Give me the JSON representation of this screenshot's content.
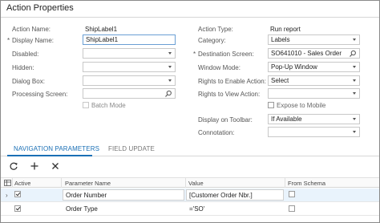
{
  "window": {
    "title": "Action Properties"
  },
  "form": {
    "action_name_label": "Action Name:",
    "action_name_value": "ShipLabel1",
    "display_name_label": "Display Name:",
    "display_name_value": "ShipLabel1",
    "disabled_label": "Disabled:",
    "hidden_label": "Hidden:",
    "dialog_box_label": "Dialog Box:",
    "processing_screen_label": "Processing Screen:",
    "batch_mode_label": "Batch Mode",
    "batch_mode_checked": false,
    "action_type_label": "Action Type:",
    "action_type_value": "Run report",
    "category_label": "Category:",
    "category_value": "Labels",
    "destination_screen_label": "Destination Screen:",
    "destination_screen_value": "SO641010 - Sales Order",
    "window_mode_label": "Window Mode:",
    "window_mode_value": "Pop-Up Window",
    "rights_enable_label": "Rights to Enable Action:",
    "rights_enable_value": "Select",
    "rights_view_label": "Rights to View Action:",
    "expose_mobile_label": "Expose to Mobile",
    "expose_mobile_checked": false,
    "display_toolbar_label": "Display on Toolbar:",
    "display_toolbar_value": "If Available",
    "connotation_label": "Connotation:",
    "required_marker": "*"
  },
  "tabs": [
    {
      "label": "NAVIGATION PARAMETERS",
      "active": true
    },
    {
      "label": "FIELD UPDATE",
      "active": false
    }
  ],
  "toolbar": {
    "refresh_icon": "refresh-icon",
    "add_icon": "plus-icon",
    "delete_icon": "close-icon"
  },
  "grid": {
    "columns": [
      "Active",
      "Parameter Name",
      "Value",
      "From Schema"
    ],
    "rows": [
      {
        "active": true,
        "parameter_name": "Order Number",
        "value": "[Customer Order Nbr.]",
        "from_schema": false
      },
      {
        "active": true,
        "parameter_name": "Order Type",
        "value": "='SO'",
        "from_schema": false
      }
    ],
    "row_marker": "›"
  },
  "colors": {
    "accent": "#1a6fb5",
    "focus_border": "#6a9fd4",
    "selected_row": "#e9f3fc"
  }
}
